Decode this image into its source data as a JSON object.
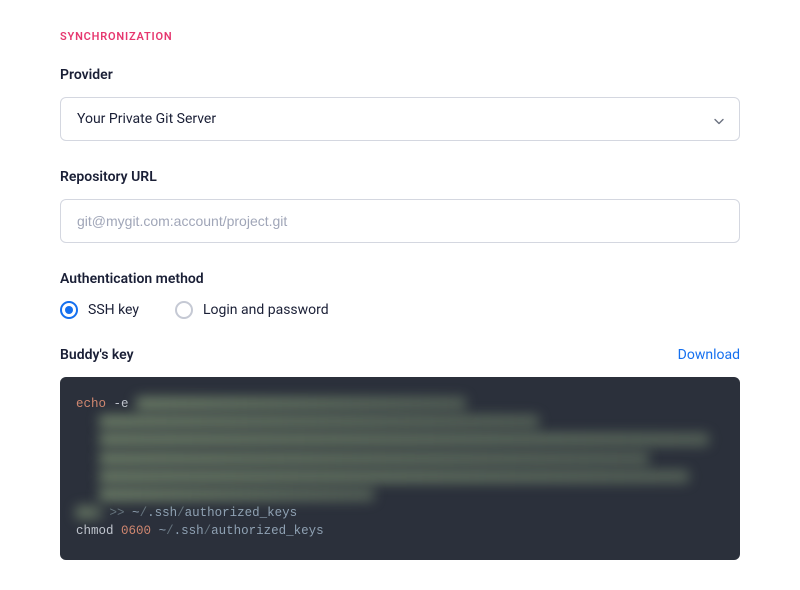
{
  "section_header": "SYNCHRONIZATION",
  "provider": {
    "label": "Provider",
    "selected": "Your Private Git Server"
  },
  "repo_url": {
    "label": "Repository URL",
    "placeholder": "git@mygit.com:account/project.git",
    "value": ""
  },
  "auth": {
    "label": "Authentication method",
    "options": {
      "ssh": "SSH key",
      "login": "Login and password"
    },
    "selected": "ssh"
  },
  "key_panel": {
    "label": "Buddy's key",
    "download": "Download"
  },
  "code": {
    "echo": "echo",
    "flag_e": "-e",
    "redirect": ">>",
    "tilde": "~",
    "slash": "/",
    "dot": ".",
    "ssh": "ssh",
    "authorized_keys": "authorized_keys",
    "chmod": "chmod",
    "mode": "0600"
  }
}
